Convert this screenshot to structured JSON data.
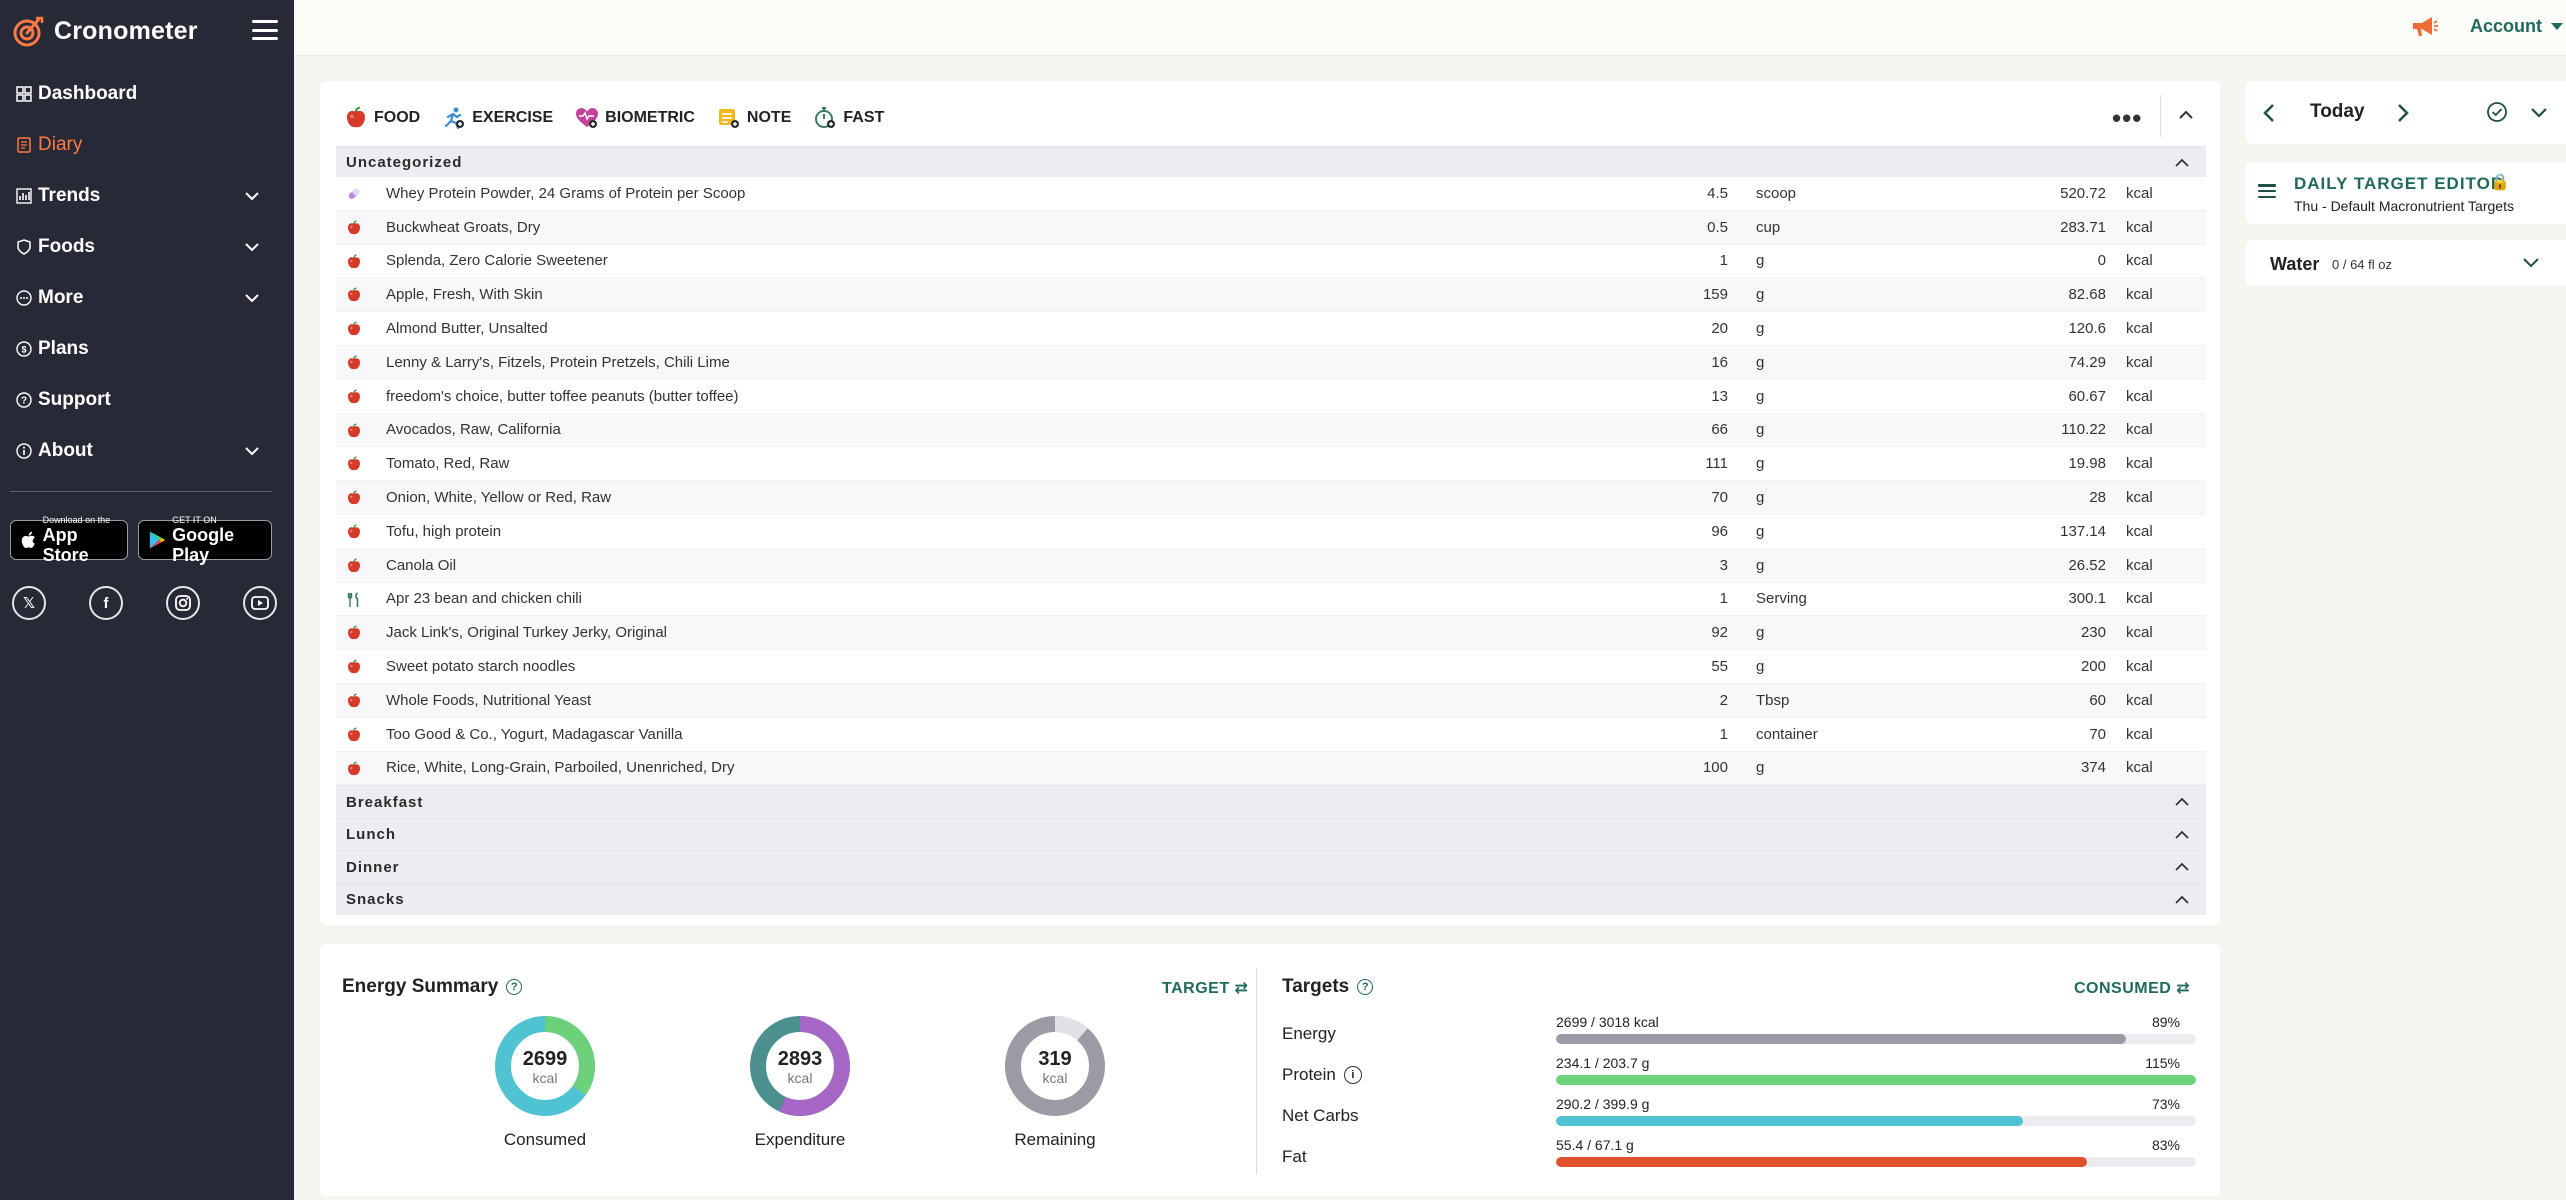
{
  "brand": {
    "name": "Cronometer"
  },
  "sidebar": {
    "items": [
      {
        "label": "Dashboard",
        "icon": "dashboard-icon",
        "expandable": false,
        "active": false
      },
      {
        "label": "Diary",
        "icon": "diary-icon",
        "expandable": false,
        "active": true
      },
      {
        "label": "Trends",
        "icon": "chart-icon",
        "expandable": true,
        "active": false
      },
      {
        "label": "Foods",
        "icon": "shield-icon",
        "expandable": true,
        "active": false
      },
      {
        "label": "More",
        "icon": "more-icon",
        "expandable": true,
        "active": false
      },
      {
        "label": "Plans",
        "icon": "plans-icon",
        "expandable": false,
        "active": false
      },
      {
        "label": "Support",
        "icon": "help-icon",
        "expandable": false,
        "active": false
      },
      {
        "label": "About",
        "icon": "info-icon",
        "expandable": true,
        "active": false
      }
    ],
    "app_store": {
      "small": "Download on the",
      "big": "App Store"
    },
    "google_play": {
      "small": "GET IT ON",
      "big": "Google Play"
    },
    "social": [
      "x-icon",
      "facebook-icon",
      "instagram-icon",
      "youtube-icon"
    ]
  },
  "topbar": {
    "account_label": "Account"
  },
  "add_bar": {
    "buttons": [
      {
        "label": "FOOD",
        "icon": "apple-icon"
      },
      {
        "label": "EXERCISE",
        "icon": "exercise-icon"
      },
      {
        "label": "BIOMETRIC",
        "icon": "heart-icon"
      },
      {
        "label": "NOTE",
        "icon": "note-icon"
      },
      {
        "label": "FAST",
        "icon": "stopwatch-icon"
      }
    ],
    "more": "•••"
  },
  "diary": {
    "groups": [
      {
        "name": "Uncategorized",
        "entries": [
          {
            "icon": "supplement-icon",
            "name": "Whey Protein Powder, 24 Grams of Protein per Scoop",
            "amount": "4.5",
            "unit": "scoop",
            "kcal": "520.72",
            "kcal_unit": "kcal"
          },
          {
            "icon": "apple-icon",
            "name": "Buckwheat Groats, Dry",
            "amount": "0.5",
            "unit": "cup",
            "kcal": "283.71",
            "kcal_unit": "kcal"
          },
          {
            "icon": "apple-icon",
            "name": "Splenda, Zero Calorie Sweetener",
            "amount": "1",
            "unit": "g",
            "kcal": "0",
            "kcal_unit": "kcal"
          },
          {
            "icon": "apple-icon",
            "name": "Apple, Fresh, With Skin",
            "amount": "159",
            "unit": "g",
            "kcal": "82.68",
            "kcal_unit": "kcal"
          },
          {
            "icon": "apple-icon",
            "name": "Almond Butter, Unsalted",
            "amount": "20",
            "unit": "g",
            "kcal": "120.6",
            "kcal_unit": "kcal"
          },
          {
            "icon": "apple-icon",
            "name": "Lenny & Larry's, Fitzels, Protein Pretzels, Chili Lime",
            "amount": "16",
            "unit": "g",
            "kcal": "74.29",
            "kcal_unit": "kcal"
          },
          {
            "icon": "apple-icon",
            "name": "freedom's choice, butter toffee peanuts (butter toffee)",
            "amount": "13",
            "unit": "g",
            "kcal": "60.67",
            "kcal_unit": "kcal"
          },
          {
            "icon": "apple-icon",
            "name": "Avocados, Raw, California",
            "amount": "66",
            "unit": "g",
            "kcal": "110.22",
            "kcal_unit": "kcal"
          },
          {
            "icon": "apple-icon",
            "name": "Tomato, Red, Raw",
            "amount": "111",
            "unit": "g",
            "kcal": "19.98",
            "kcal_unit": "kcal"
          },
          {
            "icon": "apple-icon",
            "name": "Onion, White, Yellow or Red, Raw",
            "amount": "70",
            "unit": "g",
            "kcal": "28",
            "kcal_unit": "kcal"
          },
          {
            "icon": "apple-icon",
            "name": "Tofu, high protein",
            "amount": "96",
            "unit": "g",
            "kcal": "137.14",
            "kcal_unit": "kcal"
          },
          {
            "icon": "apple-icon",
            "name": "Canola Oil",
            "amount": "3",
            "unit": "g",
            "kcal": "26.52",
            "kcal_unit": "kcal"
          },
          {
            "icon": "recipe-icon",
            "name": "Apr 23 bean and chicken chili",
            "amount": "1",
            "unit": "Serving",
            "kcal": "300.1",
            "kcal_unit": "kcal"
          },
          {
            "icon": "apple-icon",
            "name": "Jack Link's, Original Turkey Jerky, Original",
            "amount": "92",
            "unit": "g",
            "kcal": "230",
            "kcal_unit": "kcal"
          },
          {
            "icon": "apple-icon",
            "name": "Sweet potato starch noodles",
            "amount": "55",
            "unit": "g",
            "kcal": "200",
            "kcal_unit": "kcal"
          },
          {
            "icon": "apple-icon",
            "name": "Whole Foods, Nutritional Yeast",
            "amount": "2",
            "unit": "Tbsp",
            "kcal": "60",
            "kcal_unit": "kcal"
          },
          {
            "icon": "apple-icon",
            "name": "Too Good & Co., Yogurt, Madagascar Vanilla",
            "amount": "1",
            "unit": "container",
            "kcal": "70",
            "kcal_unit": "kcal"
          },
          {
            "icon": "apple-icon",
            "name": "Rice, White, Long-Grain, Parboiled, Unenriched, Dry",
            "amount": "100",
            "unit": "g",
            "kcal": "374",
            "kcal_unit": "kcal"
          }
        ]
      },
      {
        "name": "Breakfast",
        "entries": []
      },
      {
        "name": "Lunch",
        "entries": []
      },
      {
        "name": "Dinner",
        "entries": []
      },
      {
        "name": "Snacks",
        "entries": []
      }
    ]
  },
  "energy_summary": {
    "title": "Energy Summary",
    "toggle": "TARGET",
    "donuts": [
      {
        "value": "2699",
        "unit": "kcal",
        "label": "Consumed"
      },
      {
        "value": "2893",
        "unit": "kcal",
        "label": "Expenditure"
      },
      {
        "value": "319",
        "unit": "kcal",
        "label": "Remaining"
      }
    ]
  },
  "targets": {
    "title": "Targets",
    "toggle": "CONSUMED",
    "rows": [
      {
        "name": "Energy",
        "value": "2699 / 3018 kcal",
        "percent": "89%",
        "fill": 0.89,
        "color": "#9b9ba6",
        "info": false
      },
      {
        "name": "Protein",
        "value": "234.1 / 203.7 g",
        "percent": "115%",
        "fill": 1.0,
        "color": "#6dd07a",
        "info": true
      },
      {
        "name": "Net Carbs",
        "value": "290.2 / 399.9 g",
        "percent": "73%",
        "fill": 0.73,
        "color": "#4fc3d2",
        "info": false
      },
      {
        "name": "Fat",
        "value": "55.4 / 67.1 g",
        "percent": "83%",
        "fill": 0.83,
        "color": "#e0522d",
        "info": false
      }
    ]
  },
  "right_panel": {
    "date_label": "Today",
    "target_editor_title": "DAILY TARGET EDITOR",
    "target_editor_sub": "Thu - Default Macronutrient Targets",
    "water_title": "Water",
    "water_value": "0 / 64 fl oz"
  },
  "colors": {
    "accent": "#ff7a45",
    "brand_green": "#1f6a5b",
    "sidebar_bg": "#272a36",
    "page_bg": "#f6f5ef"
  }
}
